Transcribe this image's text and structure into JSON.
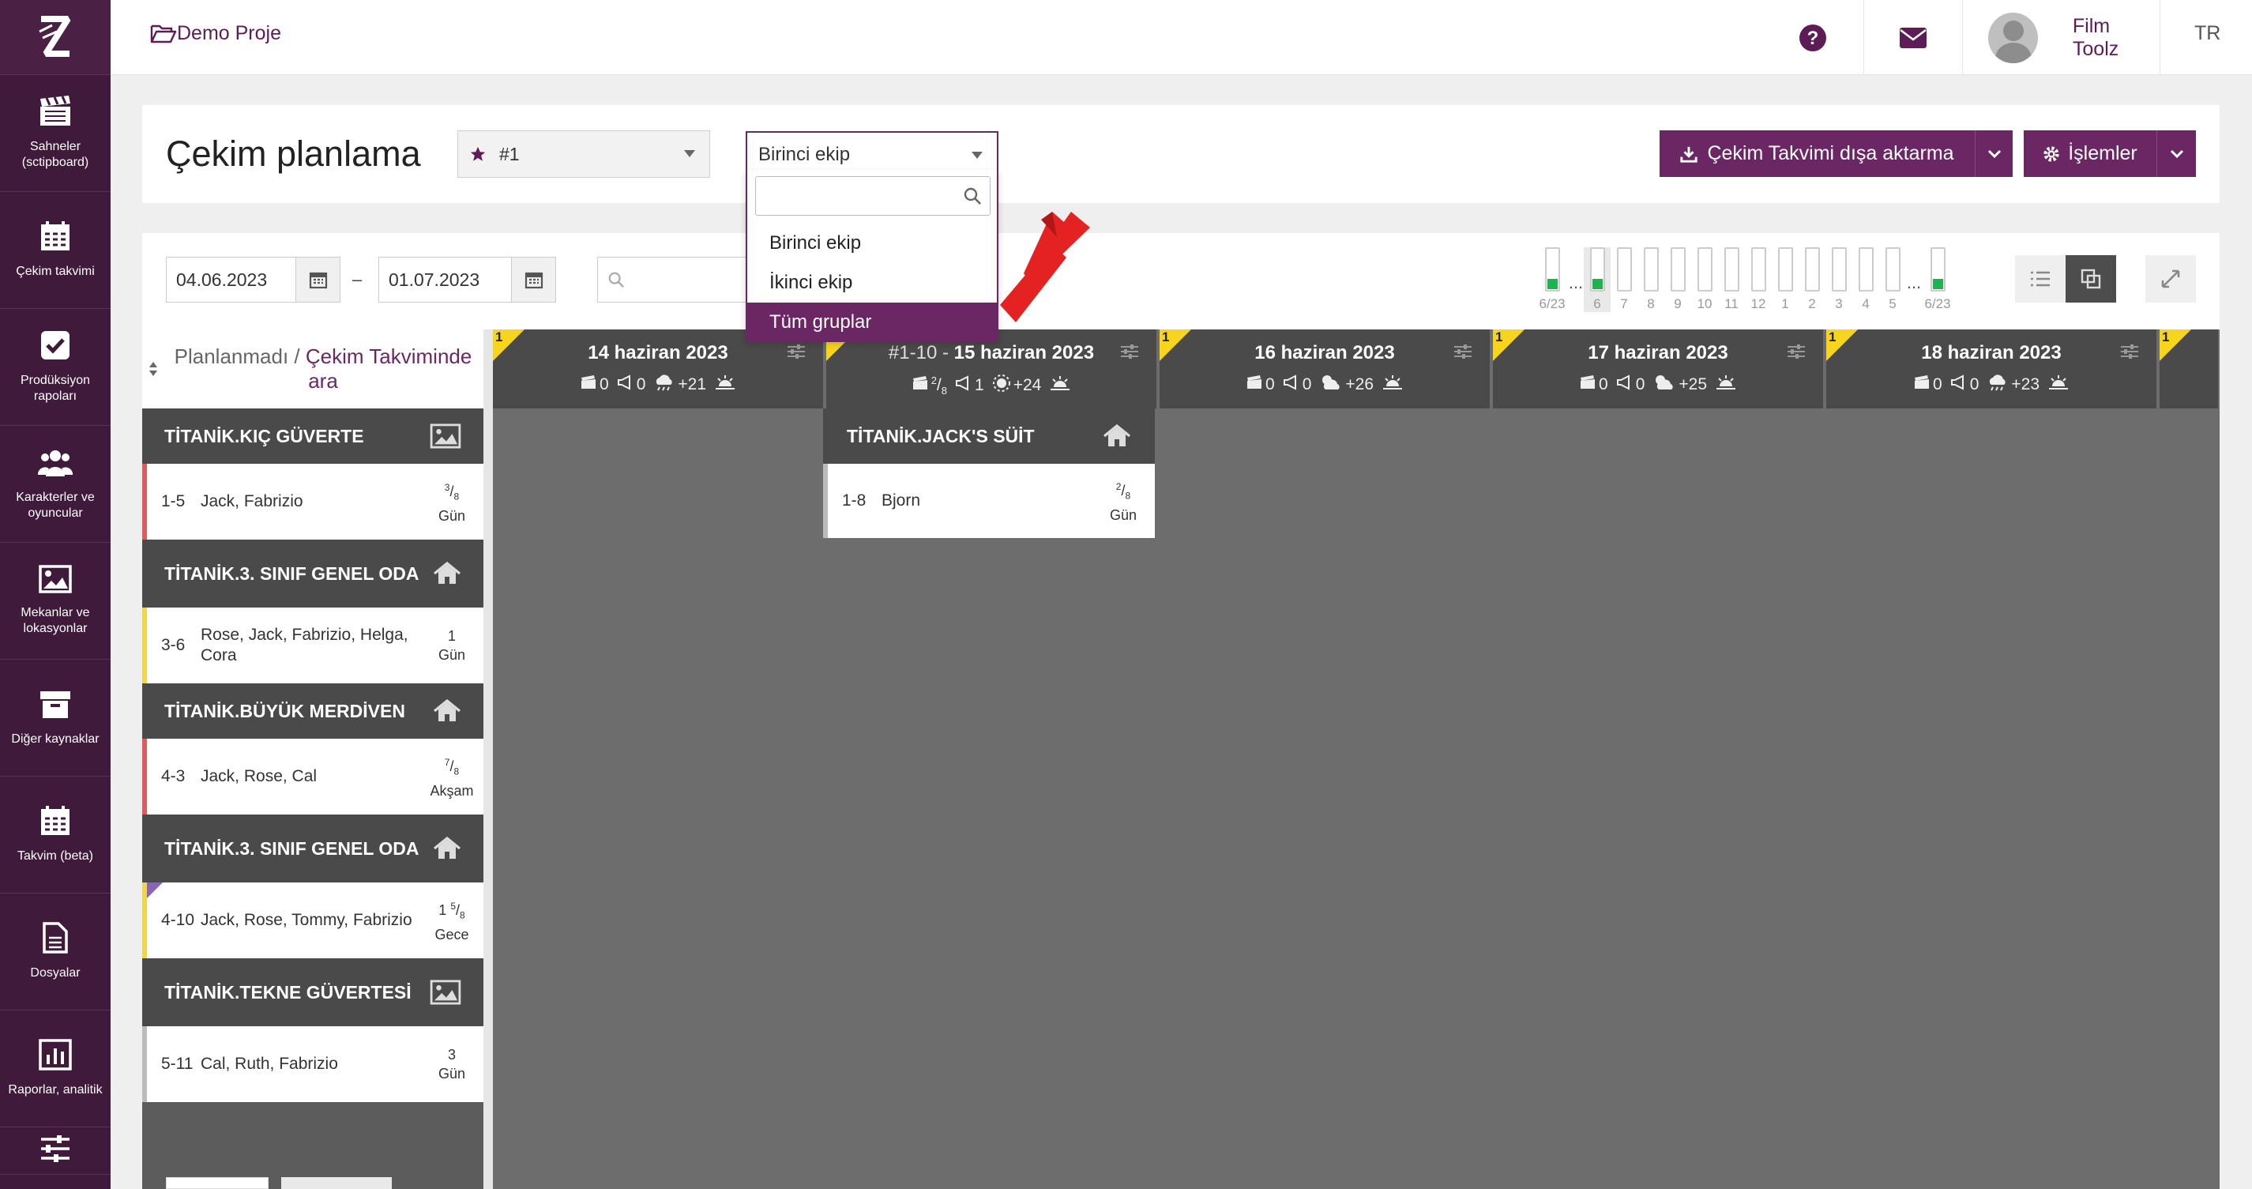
{
  "sidebar": {
    "logo": "Z",
    "items": [
      {
        "label": "Sahneler (sctipboard)",
        "icon": "clapperboard-icon"
      },
      {
        "label": "Çekim takvimi",
        "icon": "calendar-icon"
      },
      {
        "label": "Prodüksiyon rapoları",
        "icon": "checkbox-icon"
      },
      {
        "label": "Karakterler ve oyuncular",
        "icon": "users-icon"
      },
      {
        "label": "Mekanlar ve lokasyonlar",
        "icon": "image-icon"
      },
      {
        "label": "Diğer kaynaklar",
        "icon": "archive-icon"
      },
      {
        "label": "Takvim (beta)",
        "icon": "calendar-icon"
      },
      {
        "label": "Dosyalar",
        "icon": "file-icon"
      },
      {
        "label": "Raporlar, analitik",
        "icon": "bar-chart-icon"
      },
      {
        "label": "",
        "icon": "sliders-icon"
      }
    ]
  },
  "topbar": {
    "project": "Demo Proje",
    "user": "Film Toolz",
    "lang": "TR"
  },
  "header": {
    "title": "Çekim planlama",
    "schedule_select": "#1",
    "unit_select": "Birinci ekip",
    "export_label": "Çekim Takvimi dışa aktarma",
    "ops_label": "İşlemler"
  },
  "filters": {
    "date_from": "04.06.2023",
    "date_to": "01.07.2023",
    "date_sep": "–"
  },
  "dropdown": {
    "search_value": "",
    "options": [
      "Birinci ekip",
      "İkinci ekip",
      "Tüm gruplar"
    ],
    "selected_index": 2
  },
  "dayview": {
    "start_label": "6/23",
    "end_label": "6/23",
    "dots": "...",
    "days": [
      {
        "label": "6",
        "filled": true,
        "highlight": true
      },
      {
        "label": "7",
        "filled": false
      },
      {
        "label": "8",
        "filled": false
      },
      {
        "label": "9",
        "filled": false
      },
      {
        "label": "10",
        "filled": false
      },
      {
        "label": "11",
        "filled": false
      },
      {
        "label": "12",
        "filled": false
      },
      {
        "label": "1",
        "filled": false
      },
      {
        "label": "2",
        "filled": false
      },
      {
        "label": "3",
        "filled": false
      },
      {
        "label": "4",
        "filled": false
      },
      {
        "label": "5",
        "filled": false
      }
    ]
  },
  "unplanned": {
    "title_a": "Planlanmadı",
    "sep": " / ",
    "title_b": "Çekim Takviminde ara",
    "groups": [
      {
        "location": "TİTANİK.KIÇ GÜVERTE",
        "loc_icon": "image-icon",
        "scene": {
          "num": "1-5",
          "chars": "Jack, Fabrizio",
          "len_num": "3",
          "len_den": "8",
          "time": "Gün",
          "color": "#e05b5b"
        }
      },
      {
        "location": "TİTANİK.3. SINIF GENEL ODA",
        "loc_icon": "home-icon",
        "scene": {
          "num": "3-6",
          "chars": "Rose, Jack, Fabrizio, Helga, Cora",
          "len_whole": "1",
          "time": "Gün",
          "color": "#f0d64a"
        }
      },
      {
        "location": "TİTANİK.BÜYÜK MERDİVEN",
        "loc_icon": "home-icon",
        "scene": {
          "num": "4-3",
          "chars": "Jack, Rose, Cal",
          "len_num": "7",
          "len_den": "8",
          "time": "Akşam",
          "color": "#e05b5b"
        }
      },
      {
        "location": "TİTANİK.3. SINIF GENEL ODA",
        "loc_icon": "home-icon",
        "scene": {
          "num": "4-10",
          "chars": "Jack, Rose, Tommy, Fabrizio",
          "len_whole": "1",
          "len_num": "5",
          "len_den": "8",
          "time": "Gece",
          "color": "#f0d64a"
        }
      },
      {
        "location": "TİTANİK.TEKNE GÜVERTESİ",
        "loc_icon": "image-icon",
        "scene": {
          "num": "5-11",
          "chars": "Cal, Ruth, Fabrizio",
          "len_whole": "3",
          "time": "Gün",
          "color": "#bbbbbb"
        }
      }
    ]
  },
  "days": [
    {
      "prefix": "",
      "date": "14 haziran 2023",
      "flag": "1",
      "a": "0",
      "b": "0",
      "temp": "+21",
      "weather": "cloud-rain-icon"
    },
    {
      "prefix": "#1-10 - ",
      "date": "15 haziran 2023",
      "flag": "1",
      "a_num": "2",
      "a_den": "8",
      "b": "1",
      "temp": "+24",
      "weather": "sun-icon"
    },
    {
      "prefix": "",
      "date": "16 haziran 2023",
      "flag": "1",
      "a": "0",
      "b": "0",
      "temp": "+26",
      "weather": "cloud-sun-icon"
    },
    {
      "prefix": "",
      "date": "17 haziran 2023",
      "flag": "1",
      "a": "0",
      "b": "0",
      "temp": "+25",
      "weather": "cloud-sun-icon"
    },
    {
      "prefix": "",
      "date": "18 haziran 2023",
      "flag": "1",
      "a": "0",
      "b": "0",
      "temp": "+23",
      "weather": "cloud-rain-icon"
    }
  ],
  "day_planned": {
    "location": "TİTANİK.JACK'S SÜİT",
    "scene_num": "1-8",
    "scene_chars": "Bjorn",
    "len_num": "2",
    "len_den": "8",
    "time": "Gün"
  },
  "colors": {
    "brand": "#6b2764",
    "sidebar": "#3f1a3a",
    "flag": "#f7d51d",
    "progress": "#1db34e"
  }
}
